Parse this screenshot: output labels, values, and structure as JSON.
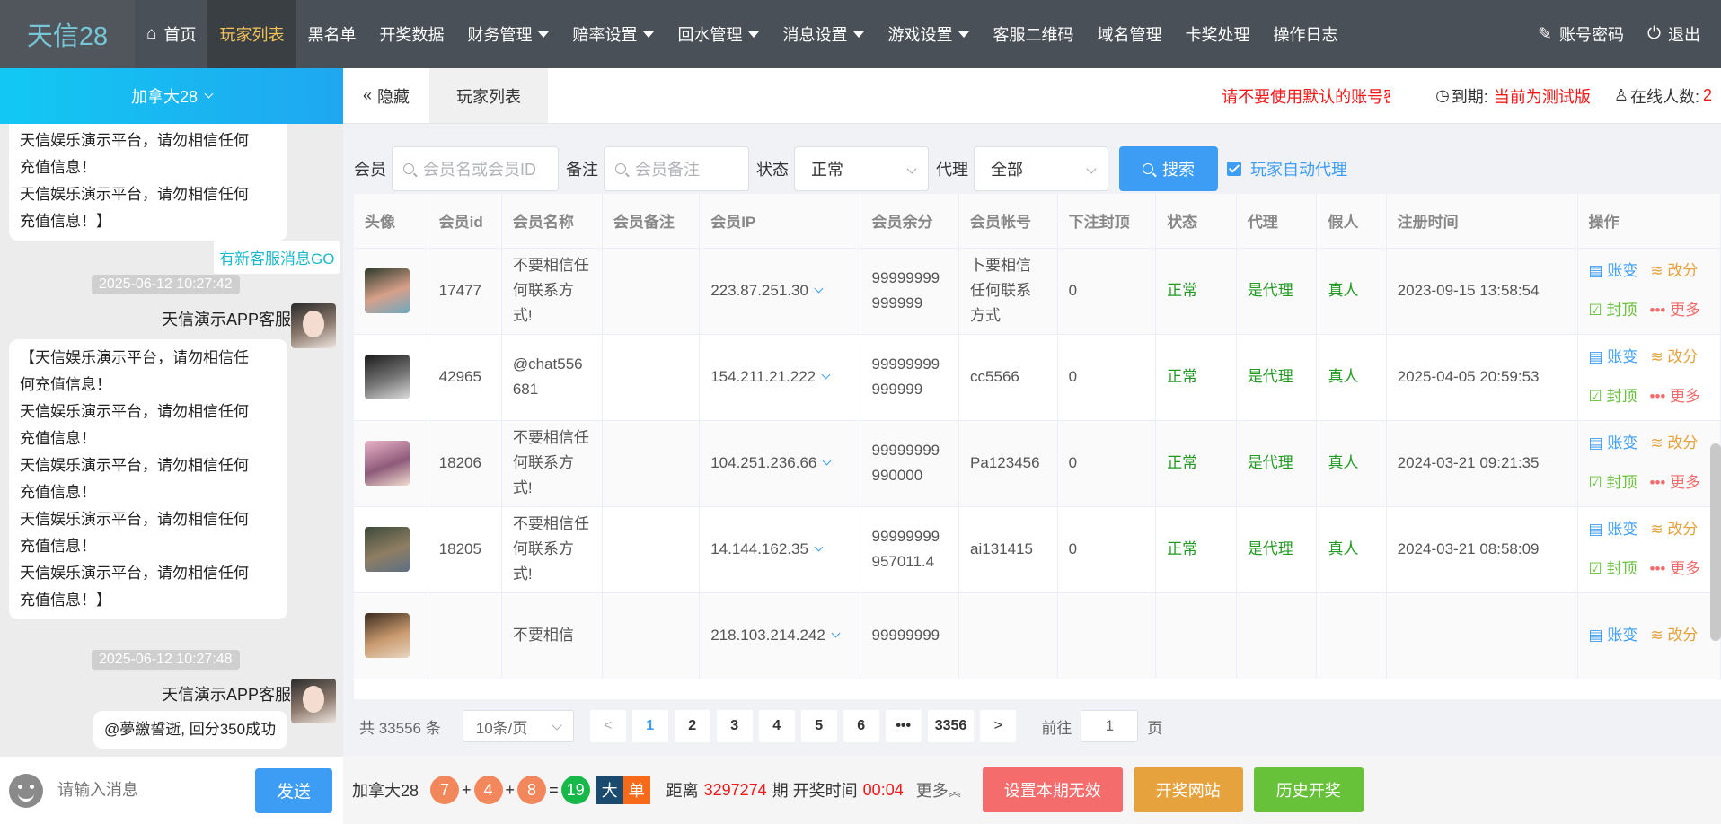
{
  "brand": "天信28",
  "nav": [
    {
      "label": "首页",
      "icon": "home-icon",
      "caret": false,
      "active": false
    },
    {
      "label": "玩家列表",
      "caret": false,
      "active": true
    },
    {
      "label": "黑名单",
      "caret": false,
      "active": false
    },
    {
      "label": "开奖数据",
      "caret": false,
      "active": false
    },
    {
      "label": "财务管理",
      "caret": true,
      "active": false
    },
    {
      "label": "赔率设置",
      "caret": true,
      "active": false
    },
    {
      "label": "回水管理",
      "caret": true,
      "active": false
    },
    {
      "label": "消息设置",
      "caret": true,
      "active": false
    },
    {
      "label": "游戏设置",
      "caret": true,
      "active": false
    },
    {
      "label": "客服二维码",
      "caret": false,
      "active": false
    },
    {
      "label": "域名管理",
      "caret": false,
      "active": false
    },
    {
      "label": "卡奖处理",
      "caret": false,
      "active": false
    },
    {
      "label": "操作日志",
      "caret": false,
      "active": false
    }
  ],
  "nav_right": {
    "account": "账号密码",
    "logout": "退出"
  },
  "chat": {
    "header": "加拿大28",
    "new_msg": "有新客服消息GO",
    "messages": [
      {
        "lines": [
          "天信娱乐演示平台，请勿相信任何",
          "充值信息！",
          "天信娱乐演示平台，请勿相信任何",
          "充值信息！】"
        ]
      },
      {
        "time": "2025-06-12 10:27:42",
        "sender": "天信演示APP客服",
        "lines": [
          "【天信娱乐演示平台，请勿相信任",
          "何充值信息！",
          "天信娱乐演示平台，请勿相信任何",
          "充值信息！",
          "天信娱乐演示平台，请勿相信任何",
          "充值信息！",
          "天信娱乐演示平台，请勿相信任何",
          "充值信息！",
          "天信娱乐演示平台，请勿相信任何",
          "充值信息！】"
        ]
      },
      {
        "time": "2025-06-12 10:27:48",
        "sender": "天信演示APP客服",
        "lines": [
          "@夢繳誓逝, 回分350成功"
        ]
      }
    ],
    "input_placeholder": "请输入消息",
    "send": "发送"
  },
  "tabs": {
    "hide": "隐藏",
    "current": "玩家列表"
  },
  "notice": {
    "warn": "请不要使用默认的账号密码",
    "expire_label": "到期:",
    "expire_value": "当前为测试版",
    "online_label": "在线人数:",
    "online_value": "2"
  },
  "filter": {
    "member_label": "会员",
    "member_placeholder": "会员名或会员ID",
    "remark_label": "备注",
    "remark_placeholder": "会员备注",
    "status_label": "状态",
    "status_value": "正常",
    "agent_label": "代理",
    "agent_value": "全部",
    "search": "搜索",
    "auto_agent": "玩家自动代理"
  },
  "table": {
    "headers": [
      "头像",
      "会员id",
      "会员名称",
      "会员备注",
      "会员IP",
      "会员余分",
      "会员帐号",
      "下注封顶",
      "状态",
      "代理",
      "假人",
      "注册时间",
      "操作"
    ],
    "rows": [
      {
        "id": "17477",
        "name": "不要相信任何联系方式!",
        "remark": "",
        "ip": "223.87.251.30",
        "balance": "99999999999999",
        "account": "卜要相信任何联系方式",
        "cap": "0",
        "status": "正常",
        "agent": "是代理",
        "fake": "真人",
        "reg": "2023-09-15 13:58:54",
        "avatar_colors": [
          "#2e3b2c",
          "#d7a08a",
          "#6fa8c0"
        ]
      },
      {
        "id": "42965",
        "name": "@chat556681",
        "remark": "",
        "ip": "154.211.21.222",
        "balance": "99999999999999",
        "account": "cc5566",
        "cap": "0",
        "status": "正常",
        "agent": "是代理",
        "fake": "真人",
        "reg": "2025-04-05 20:59:53",
        "avatar_colors": [
          "#1a1a1a",
          "#777777",
          "#dddddd"
        ]
      },
      {
        "id": "18206",
        "name": "不要相信任何联系方式!",
        "remark": "",
        "ip": "104.251.236.66",
        "balance": "99999999990000",
        "account": "Pa123456",
        "cap": "0",
        "status": "正常",
        "agent": "是代理",
        "fake": "真人",
        "reg": "2024-03-21 09:21:35",
        "avatar_colors": [
          "#e9b4c8",
          "#8e5a7a",
          "#f1dcd0"
        ]
      },
      {
        "id": "18205",
        "name": "不要相信任何联系方式!",
        "remark": "",
        "ip": "14.144.162.35",
        "balance": "99999999957011.4",
        "account": "ai131415",
        "cap": "0",
        "status": "正常",
        "agent": "是代理",
        "fake": "真人",
        "reg": "2024-03-21 08:58:09",
        "avatar_colors": [
          "#3d4a3a",
          "#8f7e63",
          "#5c6f84"
        ]
      },
      {
        "id": "",
        "name": "不要相信",
        "remark": "",
        "ip": "218.103.214.242",
        "balance": "99999999",
        "account": "",
        "cap": "",
        "status": "",
        "agent": "",
        "fake": "",
        "reg": "",
        "avatar_colors": [
          "#3a2a1f",
          "#c99a6e",
          "#e8d5c0"
        ]
      }
    ],
    "ops": {
      "ledger": "账变",
      "edit": "改分",
      "block": "封顶",
      "more": "更多"
    }
  },
  "pager": {
    "total": "共 33556 条",
    "size": "10条/页",
    "pages": [
      "1",
      "2",
      "3",
      "4",
      "5",
      "6",
      "•••",
      "3356"
    ],
    "goto_label": "前往",
    "goto_value": "1",
    "page_unit": "页"
  },
  "bottom": {
    "game": "加拿大28",
    "balls": [
      "7",
      "4",
      "8"
    ],
    "sum": "19",
    "size_tag": "大",
    "parity_tag": "单",
    "distance_label": "距离",
    "period": "3297274",
    "period_label": "期 开奖时间",
    "countdown": "00:04",
    "more": "更多",
    "btn_invalid": "设置本期无效",
    "btn_site": "开奖网站",
    "btn_history": "历史开奖",
    "colors": {
      "size_tag": "#1a4a6e",
      "parity_tag": "#f76a1a",
      "invalid": "#f56c6c",
      "site": "#e6a23c",
      "history": "#67c23a"
    }
  }
}
